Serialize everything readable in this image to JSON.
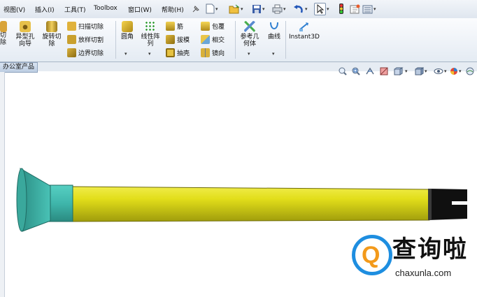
{
  "menus": [
    "视图(V)",
    "插入(I)",
    "工具(T)",
    "Toolbox",
    "窗口(W)",
    "帮助(H)"
  ],
  "ribbon": {
    "cut_left": "切\n除",
    "hole_wizard": "异型孔\n向导",
    "revolved_cut": "旋转切\n除",
    "swept_cut": "扫描切除",
    "lofted_cut": "放样切割",
    "boundary_cut": "边界切除",
    "fillet": "圆角",
    "linear_pattern": "线性阵\n列",
    "rib": "筋",
    "draft": "拔模",
    "shell": "抽壳",
    "wrap": "包覆",
    "intersect": "相交",
    "mirror": "镜向",
    "reference_geometry": "参考几\n何体",
    "curves": "曲线",
    "instant3d": "Instant3D"
  },
  "doc_tab": "办公室产品",
  "watermark": {
    "logo_letter": "Q",
    "title": "查询啦",
    "url": "chaxunla.com"
  },
  "colors": {
    "shaft": "#e2de1a",
    "shaft_shadow": "#9f9c0c",
    "collar": "#3fb6ab",
    "funnel": "#3aa89c",
    "end_cap": "#101010",
    "brand_blue": "#1e8ee0",
    "brand_orange": "#f39a1b"
  }
}
